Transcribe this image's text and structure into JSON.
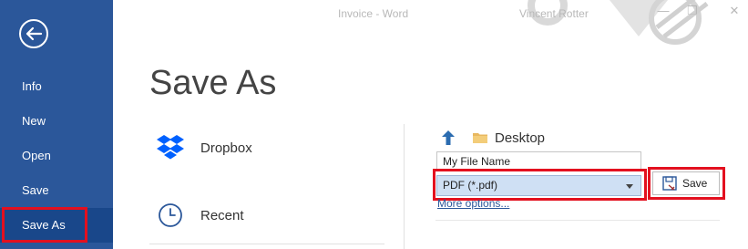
{
  "titlebar": {
    "document": "Invoice - Word",
    "user": "Vincent Rotter",
    "minimize_glyph": "—",
    "restore_glyph": "❐",
    "close_glyph": "✕"
  },
  "sidebar": {
    "back_icon": "back-arrow-circle-icon",
    "items": [
      {
        "label": "Info"
      },
      {
        "label": "New"
      },
      {
        "label": "Open"
      },
      {
        "label": "Save"
      },
      {
        "label": "Save As"
      }
    ],
    "selected": "Save As",
    "background": "#2b579a"
  },
  "main": {
    "title": "Save As",
    "locations": [
      {
        "label": "Dropbox",
        "icon": "dropbox-icon"
      },
      {
        "label": "Recent",
        "icon": "clock-icon"
      }
    ]
  },
  "save_panel": {
    "current_folder": "Desktop",
    "filename_value": "My File Name",
    "filetype_selected": "PDF (*.pdf)",
    "save_label": "Save",
    "more_options": "More options..."
  },
  "colors": {
    "accent": "#2b579a",
    "highlight_box": "#e3101f",
    "dropdown_bg": "#cfe0f4",
    "up_arrow": "#2b6cb0",
    "folder": "#e8b860"
  }
}
